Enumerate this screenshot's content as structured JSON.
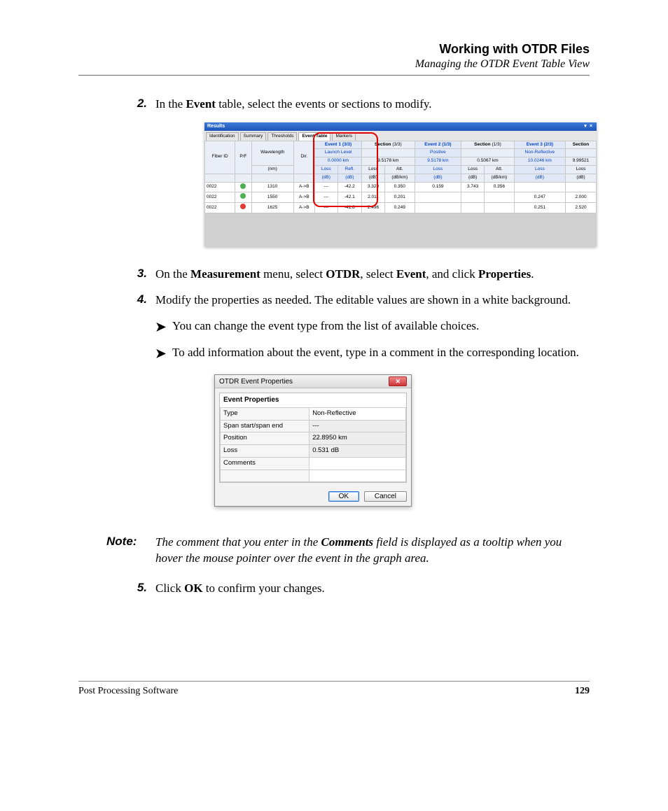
{
  "header": {
    "title": "Working with OTDR Files",
    "subtitle": "Managing the OTDR Event Table View"
  },
  "steps": {
    "s2": {
      "num": "2.",
      "pre": "In the ",
      "b1": "Event",
      "post": " table, select the events or sections to modify."
    },
    "s3": {
      "num": "3.",
      "pre": "On the ",
      "b1": "Measurement",
      "mid1": " menu, select ",
      "b2": "OTDR",
      "mid2": ", select ",
      "b3": "Event",
      "mid3": ", and click ",
      "b4": "Properties",
      "end": "."
    },
    "s4": {
      "num": "4.",
      "text": "Modify the properties as needed. The editable values are shown in a white background.",
      "bul1": "You can change the event type from the list of available choices.",
      "bul2": "To add information about the event, type in a comment in the corresponding location."
    },
    "s5": {
      "num": "5.",
      "pre": "Click ",
      "b1": "OK",
      "post": " to confirm your changes."
    }
  },
  "note": {
    "label": "Note:",
    "pre": "The comment that you enter in the ",
    "b1": "Comments",
    "post": " field is displayed as a tooltip when you hover the mouse pointer over the event in the graph area."
  },
  "footer": {
    "left": "Post Processing Software",
    "page": "129"
  },
  "shot1": {
    "title": "Results",
    "tabs": [
      "Identification",
      "Summary",
      "Thresholds",
      "Event Table",
      "Markers"
    ],
    "active_tab_index": 3,
    "cols": {
      "fiber_id": "Fiber ID",
      "pf": "P/F",
      "wavelength": "Wavelength",
      "dir": "Dir.",
      "event1": "Event 1",
      "e1c": "(3/3)",
      "section1": "Section",
      "s1c": "(3/3)",
      "event2": "Event 2",
      "e2c": "(1/3)",
      "section2": "Section",
      "s2c": "(1/3)",
      "event3": "Event 3",
      "e3c": "(2/3)",
      "section3": "Section"
    },
    "sub1": {
      "launch": "Launch Level",
      "e2type": "Positive",
      "e3type": "Non-Reflective"
    },
    "sub2": {
      "e1pos": "0.0000 km",
      "s1pos": "9.5178 km",
      "e2pos": "9.5178 km",
      "s2pos": "0.5067 km",
      "e3pos": "10.0246 km",
      "s3pos": "9.99521"
    },
    "sub3": {
      "nm": "(nm)",
      "loss": "Loss",
      "refl": "Refl.",
      "att": "Att.",
      "db": "(dB)",
      "dbkm": "(dB/km)"
    },
    "rows": [
      {
        "fid": "0022",
        "pf": "g",
        "wl": "1310",
        "dir": "A->B",
        "e1l": "---",
        "e1r": "-42.2",
        "s1l": "3.328",
        "s1a": "0.350",
        "e2l": "0.159",
        "s2l": "3.743",
        "s2a": "0.356",
        "e3l": "",
        "s3l": ""
      },
      {
        "fid": "0022",
        "pf": "g",
        "wl": "1550",
        "dir": "A->B",
        "e1l": "---",
        "e1r": "-42.1",
        "s1l": "2.011",
        "s1a": "0.201",
        "e2l": "",
        "s2l": "",
        "s2a": "",
        "e3l": "0.247",
        "s3l": "2.000"
      },
      {
        "fid": "0022",
        "pf": "r",
        "wl": "1625",
        "dir": "A->B",
        "e1l": "---",
        "e1r": "-41.8",
        "s1l": "2.496",
        "s1a": "0.249",
        "e2l": "",
        "s2l": "",
        "s2a": "",
        "e3l": "0.251",
        "s3l": "2.520"
      }
    ]
  },
  "shot2": {
    "title": "OTDR Event Properties",
    "heading": "Event Properties",
    "rows": [
      {
        "k": "Type",
        "v": "Non-Reflective",
        "editable": true
      },
      {
        "k": "Span start/span end",
        "v": "---",
        "editable": false
      },
      {
        "k": "Position",
        "v": "22.8950 km",
        "editable": false
      },
      {
        "k": "Loss",
        "v": "0.531 dB",
        "editable": false
      },
      {
        "k": "Comments",
        "v": "",
        "editable": true
      },
      {
        "k": "",
        "v": "",
        "editable": true
      }
    ],
    "ok": "OK",
    "cancel": "Cancel"
  }
}
